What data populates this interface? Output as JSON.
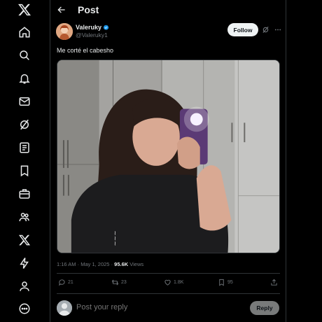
{
  "nav": {
    "items": [
      {
        "icon": "x-logo-icon"
      },
      {
        "icon": "home-icon"
      },
      {
        "icon": "search-icon"
      },
      {
        "icon": "bell-icon"
      },
      {
        "icon": "mail-icon"
      },
      {
        "icon": "grok-icon"
      },
      {
        "icon": "lists-icon"
      },
      {
        "icon": "bookmark-icon"
      },
      {
        "icon": "jobs-icon"
      },
      {
        "icon": "communities-icon"
      },
      {
        "icon": "premium-x-icon"
      },
      {
        "icon": "lightning-icon"
      },
      {
        "icon": "profile-icon"
      },
      {
        "icon": "more-circle-icon"
      }
    ]
  },
  "header": {
    "title": "Post"
  },
  "post": {
    "author": {
      "display_name": "Valeruky",
      "handle": "@Valeruky1",
      "verified": true,
      "verified_color": "#1d9bf0"
    },
    "follow_label": "Follow",
    "text": "Me corté el cabesho",
    "meta": {
      "time": "1:16 AM",
      "separator": " · ",
      "date": "May 1, 2025",
      "views_count": "95.6K",
      "views_label": " Views"
    },
    "actions": {
      "replies": "21",
      "reposts": "23",
      "likes": "1.8K",
      "bookmarks": "95"
    }
  },
  "reply": {
    "placeholder": "Post your reply",
    "button_label": "Reply"
  },
  "colors": {
    "background": "#000000",
    "text_primary": "#e7e9ea",
    "text_secondary": "#71767b",
    "border": "#2f3336",
    "accent": "#1d9bf0"
  }
}
